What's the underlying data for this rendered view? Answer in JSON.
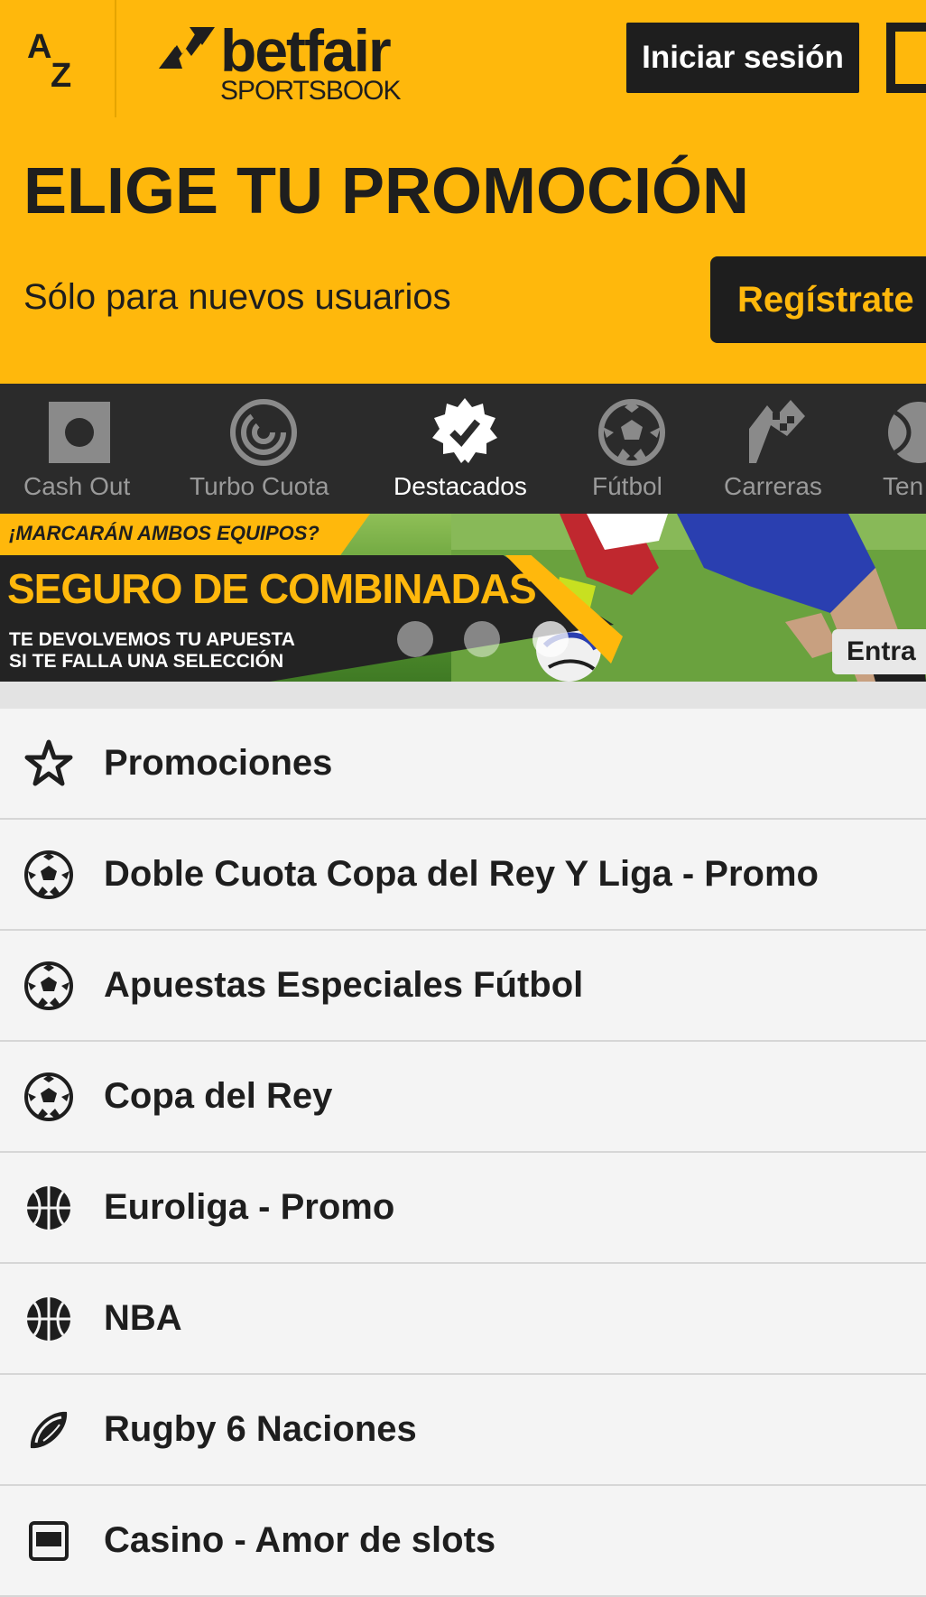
{
  "colors": {
    "brand_yellow": "#ffb80c",
    "dark": "#1e1e1e",
    "nav_bg": "#2b2b2b",
    "list_bg": "#f4f4f4"
  },
  "header": {
    "az_icon": "a-to-z-icon",
    "logo_word": "betfair",
    "logo_sub": "SPORTSBOOK",
    "login_label": "Iniciar sesión"
  },
  "promo": {
    "title": "ELIGE TU PROMOCIÓN",
    "subtitle": "Sólo para nuevos usuarios",
    "register_label": "Regístrate"
  },
  "sport_nav": {
    "items": [
      {
        "label": "Cash Out",
        "icon": "cash-out-icon",
        "active": false
      },
      {
        "label": "Turbo Cuota",
        "icon": "turbo-icon",
        "active": false
      },
      {
        "label": "Destacados",
        "icon": "featured-badge-icon",
        "active": true
      },
      {
        "label": "Fútbol",
        "icon": "soccer-ball-icon",
        "active": false
      },
      {
        "label": "Carreras",
        "icon": "racing-flag-icon",
        "active": false
      },
      {
        "label": "Ten",
        "icon": "tennis-ball-icon",
        "active": false
      }
    ]
  },
  "banner": {
    "kicker": "¡MARCARÁN AMBOS EQUIPOS?",
    "headline": "SEGURO DE COMBINADAS",
    "sub_line1": "TE DEVOLVEMOS TU APUESTA",
    "sub_line2": "SI TE FALLA UNA SELECCIÓN",
    "cta": "Entra",
    "slide_count": 3,
    "active_slide": 3
  },
  "list": {
    "items": [
      {
        "label": "Promociones",
        "icon": "star-icon"
      },
      {
        "label": "Doble Cuota Copa del Rey Y Liga - Promo",
        "icon": "soccer-ball-icon"
      },
      {
        "label": "Apuestas Especiales Fútbol",
        "icon": "soccer-ball-icon"
      },
      {
        "label": "Copa del Rey",
        "icon": "soccer-ball-icon"
      },
      {
        "label": "Euroliga - Promo",
        "icon": "basketball-icon"
      },
      {
        "label": "NBA",
        "icon": "basketball-icon"
      },
      {
        "label": "Rugby 6 Naciones",
        "icon": "rugby-ball-icon"
      },
      {
        "label": "Casino - Amor de slots",
        "icon": "slot-machine-icon"
      }
    ]
  }
}
